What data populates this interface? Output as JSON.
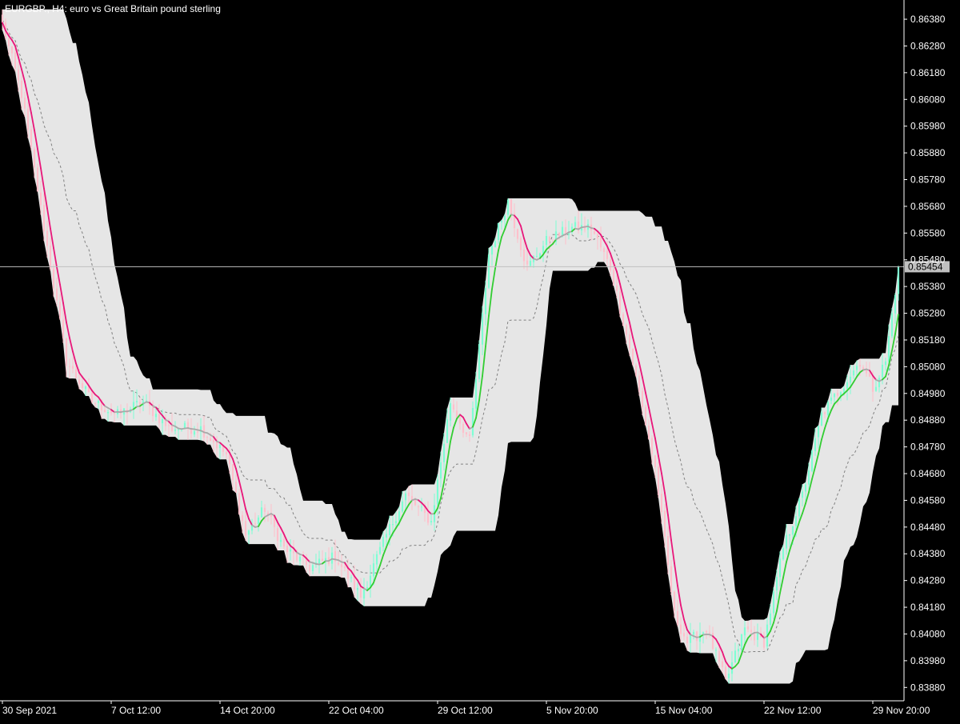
{
  "chart_data": {
    "type": "candlestick",
    "title": "EURGBP., H4:  euro vs Great Britain pound sterling",
    "symbol": "EURGBP.",
    "timeframe": "H4",
    "description": "euro vs Great Britain pound sterling",
    "y_ticks": [
      "0.86380",
      "0.86280",
      "0.86180",
      "0.86080",
      "0.85980",
      "0.85880",
      "0.85780",
      "0.85680",
      "0.85580",
      "0.85480",
      "0.85380",
      "0.85280",
      "0.85180",
      "0.85080",
      "0.84980",
      "0.84880",
      "0.84780",
      "0.84680",
      "0.84580",
      "0.84480",
      "0.84380",
      "0.84280",
      "0.84180",
      "0.84080",
      "0.83980",
      "0.83880"
    ],
    "x_ticks": [
      "30 Sep 2021",
      "7 Oct 12:00",
      "14 Oct 20:00",
      "22 Oct 04:00",
      "29 Oct 12:00",
      "5 Nov 20:00",
      "15 Nov 04:00",
      "22 Nov 12:00",
      "29 Nov 20:00"
    ],
    "ylim": [
      0.8383,
      0.8644
    ],
    "current_price": 0.85454,
    "current_price_label": "0.85454",
    "grid": false,
    "colors": {
      "background": "#000000",
      "up_candle": "#7fffd4",
      "down_candle": "#ffc0cb",
      "band_fill": "#e6e6e6",
      "midline": "#808080",
      "ma_down": "#e8177a",
      "ma_up": "#32cd32",
      "ma_neutral": "#a9a9a9",
      "price_line": "#c0c0c0",
      "axis_text": "#ffffff",
      "price_label_bg": "#c0c0c0"
    },
    "anchors": [
      [
        0,
        0.8636
      ],
      [
        6,
        0.861
      ],
      [
        13,
        0.856
      ],
      [
        20,
        0.851
      ],
      [
        28,
        0.8495
      ],
      [
        36,
        0.849
      ],
      [
        44,
        0.8495
      ],
      [
        52,
        0.8485
      ],
      [
        62,
        0.8485
      ],
      [
        70,
        0.8475
      ],
      [
        76,
        0.8445
      ],
      [
        82,
        0.8455
      ],
      [
        88,
        0.844
      ],
      [
        96,
        0.8433
      ],
      [
        104,
        0.8437
      ],
      [
        112,
        0.8422
      ],
      [
        120,
        0.8445
      ],
      [
        126,
        0.846
      ],
      [
        134,
        0.845
      ],
      [
        140,
        0.8495
      ],
      [
        146,
        0.848
      ],
      [
        152,
        0.855
      ],
      [
        158,
        0.857
      ],
      [
        164,
        0.8545
      ],
      [
        170,
        0.8555
      ],
      [
        178,
        0.856
      ],
      [
        184,
        0.856
      ],
      [
        190,
        0.8545
      ],
      [
        196,
        0.8515
      ],
      [
        204,
        0.847
      ],
      [
        210,
        0.8415
      ],
      [
        214,
        0.8405
      ],
      [
        220,
        0.841
      ],
      [
        226,
        0.839
      ],
      [
        232,
        0.841
      ],
      [
        238,
        0.8405
      ],
      [
        244,
        0.844
      ],
      [
        250,
        0.846
      ],
      [
        256,
        0.849
      ],
      [
        262,
        0.85
      ],
      [
        268,
        0.851
      ],
      [
        272,
        0.85
      ],
      [
        276,
        0.851
      ],
      [
        280,
        0.85454
      ]
    ],
    "candle_count": 281,
    "band_period": 20,
    "ma_period": 5
  }
}
